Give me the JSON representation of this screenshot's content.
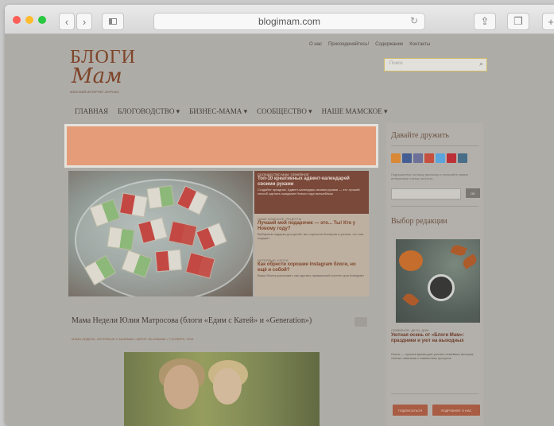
{
  "browser": {
    "url": "blogimam.com",
    "back_icon": "chevron-left",
    "forward_icon": "chevron-right",
    "sidebar_icon": "sidebar",
    "reload_icon": "reload",
    "share_icon": "share",
    "tabs_icon": "tabs"
  },
  "site": {
    "logo_line1": "БЛОГИ",
    "logo_line2": "Мам",
    "logo_tagline": "ЖЕНСКИЙ ИНТЕРНЕТ-ЖУРНАЛ",
    "top_links": [
      "О нас",
      "Присоединяйтесь!",
      "Содержание",
      "Контакты"
    ],
    "search_placeholder": "Поиск",
    "nav": [
      "ГЛАВНАЯ",
      "БЛОГОВОДСТВО ▾",
      "БИЗНЕС-МАМА ▾",
      "СООБЩЕСТВО ▾",
      "НАШЕ МАМСКОЕ ▾"
    ],
    "banner_color": "#f6a27a"
  },
  "slider": {
    "items": [
      {
        "cat": "СООБЩЕСТВО МАМ, СЕМЕЙНОЕ",
        "title": "Топ-10 креативных адвент-календарей своими руками",
        "excerpt": "Создайте праздник. Адвент-календарь своими руками — это лучший способ сделать ожидание Нового года волшебным",
        "active": true
      },
      {
        "cat": "НАШЕ МАМСКОЕ, РЕЦЕПТЫ",
        "title": "Лучший мой подарочек — это... Ты! Кто у Новому году?",
        "excerpt": "Выбираем подарки для детей: мы опросили блогеров и узнали, что они подарят",
        "active": false
      },
      {
        "cat": "ИНТЕРВЬЮ, БЛОГИ",
        "title": "Как обрести хорошие Instagram блоги, но ещё и собой?",
        "excerpt": "Ваша блогер расскажет, как сделать правильный контент для Instagram",
        "active": false
      }
    ]
  },
  "post": {
    "title": "Мама Недели Юлия Матросова (блоги «Едим с Катей» и «Generation»)",
    "meta": "МАМА НЕДЕЛИ, ИНТЕРВЬЮ С МАМАМИ   •   АВТОР: BLOGIMAM   •   7 НОЯБРЯ, 2016"
  },
  "sidebar": {
    "friends_title": "Давайте дружить",
    "social_colors": [
      "#e98a2b",
      "#3b5998",
      "#6a6e9e",
      "#d34836",
      "#55acee",
      "#c8232c",
      "#3f6b8b"
    ],
    "subscribe_text": "Подпишитесь на нашу рассылку и получайте самые интересные статьи на почту",
    "subscribe_btn": "OK",
    "editor_title": "Выбор редакции",
    "editor_cat": "СЕМЕЙНОЕ, ДЕТИ, ДОМ",
    "editor_post_title": "Уютная осень от «Блоги Мам»: праздники и уют на выходных",
    "editor_excerpt": "Осень — лучшее время для уютных семейных вечеров, теплых напитков и совместных прогулок",
    "buttons": [
      "ПОДПИСАТЬСЯ",
      "ПОДРОБНЕЕ О НАС"
    ]
  }
}
